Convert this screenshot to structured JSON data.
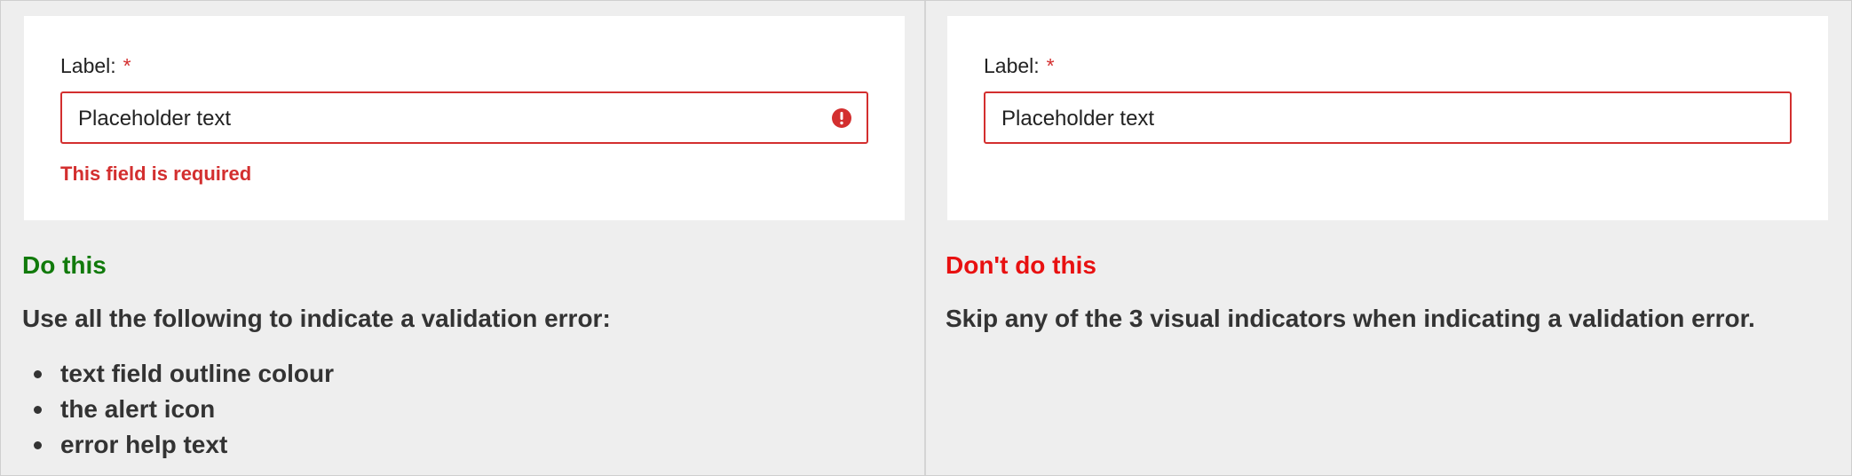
{
  "do_panel": {
    "demo": {
      "label": "Label:",
      "required_marker": "*",
      "input_value": "Placeholder text",
      "error_text": "This field is required",
      "icon": "alert-circle-icon"
    },
    "heading": "Do this",
    "description": "Use all the following to indicate a validation error:",
    "bullets": [
      "text field outline colour",
      "the alert icon",
      "error help text"
    ]
  },
  "dont_panel": {
    "demo": {
      "label": "Label:",
      "required_marker": "*",
      "input_value": "Placeholder text"
    },
    "heading": "Don't do this",
    "description": "Skip any of the 3 visual indicators when indicating a validation error."
  },
  "colors": {
    "error": "#d32f2f",
    "do_heading": "#117a0b",
    "dont_heading": "#e81010",
    "panel_background": "#eeeeee"
  }
}
